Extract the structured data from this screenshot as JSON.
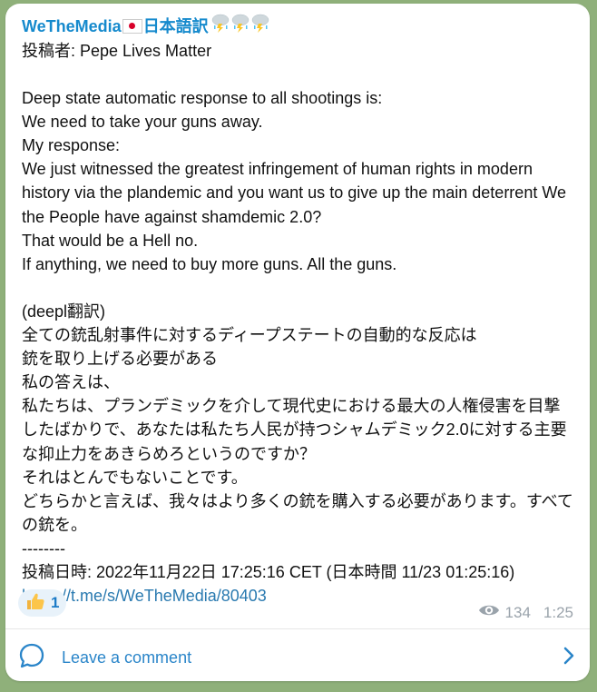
{
  "post": {
    "channel_name": "WeTheMedia",
    "channel_name_suffix": "日本語訳",
    "author_line": "投稿者: Pepe Lives Matter",
    "body_text": "Deep state automatic response to all shootings is:\nWe need to take your guns away.\nMy response:\nWe just witnessed the greatest infringement of human rights in modern history via the plandemic and you want us to give up the main deterrent We the People have against shamdemic 2.0?\nThat would be a Hell no.\nIf anything, we need to buy more guns. All the guns.\n\n(deepl翻訳)\n全ての銃乱射事件に対するディープステートの自動的な反応は\n銃を取り上げる必要がある\n私の答えは、\n私たちは、プランデミックを介して現代史における最大の人権侵害を目撃したばかりで、あなたは私たち人民が持つシャムデミック2.0に対する主要な抑止力をあきらめろというのですか？\nそれはとんでもないことです。\nどちらかと言えば、我々はより多くの銃を購入する必要があります。すべての銃を。\n--------\n投稿日時: 2022年11月22日 17:25:16 CET (日本時間 11/23 01:25:16)",
    "link": "https://t.me/s/WeTheMedia/80403"
  },
  "reaction": {
    "icon": "thumbs-up-icon",
    "count": "1"
  },
  "meta": {
    "views": "134",
    "time": "1:25"
  },
  "comment": {
    "label": "Leave a comment"
  },
  "colors": {
    "accent": "#168acd",
    "bubble": "#ffffff",
    "background": "#8fb07a"
  }
}
